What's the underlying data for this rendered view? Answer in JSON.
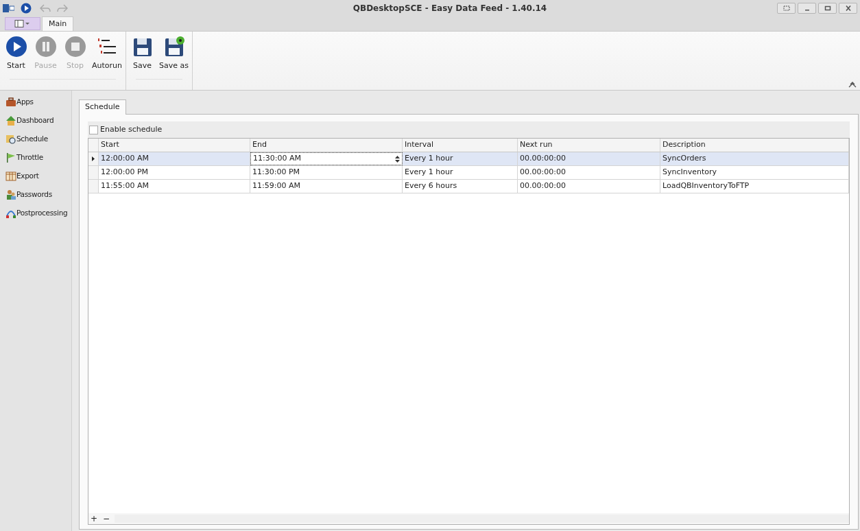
{
  "window": {
    "title": "QBDesktopSCE - Easy Data Feed - 1.40.14"
  },
  "ribbon_tabs": [
    {
      "label": "Main",
      "selected": true
    }
  ],
  "ribbon_groups": [
    {
      "buttons": [
        {
          "kind": "start",
          "label": "Start",
          "disabled": false
        },
        {
          "kind": "pause",
          "label": "Pause",
          "disabled": true
        },
        {
          "kind": "stop",
          "label": "Stop",
          "disabled": true
        },
        {
          "kind": "autorun",
          "label": "Autorun",
          "disabled": false
        }
      ]
    },
    {
      "buttons": [
        {
          "kind": "save",
          "label": "Save",
          "disabled": false
        },
        {
          "kind": "saveas",
          "label": "Save as",
          "disabled": false
        }
      ]
    }
  ],
  "sidebar": {
    "items": [
      {
        "kind": "apps",
        "label": "Apps"
      },
      {
        "kind": "dashboard",
        "label": "Dashboard"
      },
      {
        "kind": "schedule",
        "label": "Schedule"
      },
      {
        "kind": "throttle",
        "label": "Throttle"
      },
      {
        "kind": "export",
        "label": "Export"
      },
      {
        "kind": "passwords",
        "label": "Passwords"
      },
      {
        "kind": "postprocessing",
        "label": "Postprocessing"
      }
    ]
  },
  "content_tabs": [
    {
      "label": "Schedule",
      "selected": true
    }
  ],
  "enable_schedule": {
    "label": "Enable schedule",
    "checked": false
  },
  "table": {
    "columns": [
      "Start",
      "End",
      "Interval",
      "Next run",
      "Description"
    ],
    "rows": [
      {
        "selected": true,
        "editing": true,
        "cells": [
          "12:00:00 AM",
          "11:30:00 AM",
          "Every 1 hour",
          "00.00:00:00",
          "SyncOrders"
        ]
      },
      {
        "selected": false,
        "editing": false,
        "cells": [
          "12:00:00 PM",
          "11:30:00 PM",
          "Every 1 hour",
          "00.00:00:00",
          "SyncInventory"
        ]
      },
      {
        "selected": false,
        "editing": false,
        "cells": [
          "11:55:00 AM",
          "11:59:00 AM",
          "Every 6 hours",
          "00.00:00:00",
          "LoadQBInventoryToFTP"
        ]
      }
    ]
  },
  "navigator": [
    "+",
    "−"
  ]
}
